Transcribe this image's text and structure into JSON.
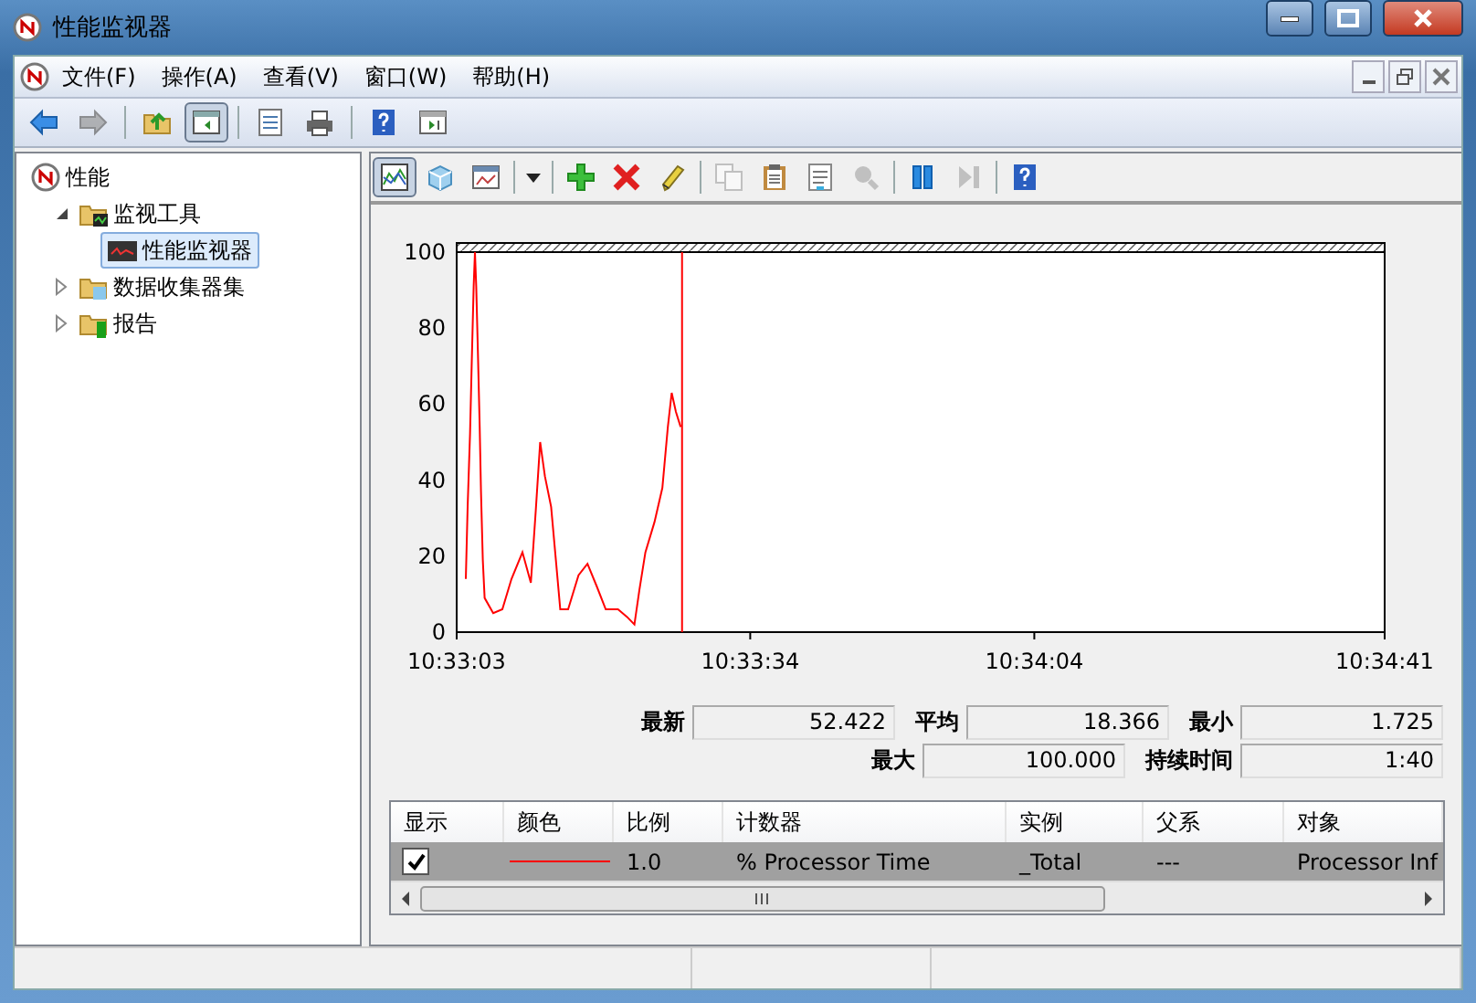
{
  "window": {
    "title": "性能监视器"
  },
  "menu": [
    "文件(F)",
    "操作(A)",
    "查看(V)",
    "窗口(W)",
    "帮助(H)"
  ],
  "toolbar": [
    {
      "pressed": false,
      "disabled": false
    },
    {
      "pressed": false,
      "disabled": true
    },
    {
      "pressed": false,
      "disabled": false
    },
    {
      "pressed": true,
      "disabled": false
    },
    {
      "pressed": false,
      "disabled": false
    },
    {
      "pressed": false,
      "disabled": false
    },
    {
      "pressed": false,
      "disabled": false
    },
    {
      "pressed": false,
      "disabled": false
    }
  ],
  "tree": [
    {
      "label": "性能",
      "selected": false,
      "children": [
        {
          "label": "监视工具",
          "expanded": true,
          "selected": false,
          "children": [
            {
              "label": "性能监视器",
              "selected": true
            }
          ]
        },
        {
          "label": "数据收集器集",
          "expanded": false,
          "selected": false
        },
        {
          "label": "报告",
          "expanded": false,
          "selected": false
        }
      ]
    }
  ],
  "graph_toolbar": [
    {
      "pressed": true,
      "disabled": false
    },
    {
      "pressed": false,
      "disabled": false
    },
    {
      "pressed": false,
      "disabled": false
    },
    {
      "pressed": false,
      "disabled": false
    },
    {
      "pressed": false,
      "disabled": false
    },
    {
      "pressed": false,
      "disabled": false
    },
    {
      "pressed": false,
      "disabled": false
    },
    {
      "pressed": false,
      "disabled": true
    },
    {
      "pressed": false,
      "disabled": false
    },
    {
      "pressed": false,
      "disabled": false
    },
    {
      "pressed": false,
      "disabled": true
    },
    {
      "pressed": false,
      "disabled": false
    },
    {
      "pressed": false,
      "disabled": true
    },
    {
      "pressed": false,
      "disabled": false
    }
  ],
  "graph": {
    "chart_data": {
      "type": "line",
      "xlim": [
        37983,
        38081
      ],
      "ylim": [
        0,
        100
      ],
      "yticks": [
        0,
        20,
        40,
        60,
        80,
        100
      ],
      "xticks": [
        {
          "value": 37983,
          "label": "10:33:03"
        },
        {
          "value": 38014,
          "label": "10:33:34"
        },
        {
          "value": 38044,
          "label": "10:34:04"
        },
        {
          "value": 38081,
          "label": "10:34:41"
        }
      ],
      "x": [
        37983.96,
        37984.16,
        37984.41,
        37984.61,
        37984.8,
        37984.93,
        37985.06,
        37985.25,
        37985.44,
        37985.57,
        37985.76,
        37985.96,
        37986.86,
        37987.82,
        37988.79,
        37989.94,
        37990.84,
        37991.36,
        37991.81,
        37992.32,
        37992.97,
        37993.48,
        37993.93,
        37994.77,
        37995.86,
        37996.82,
        37997.79,
        37998.75,
        38000.04,
        38001.0,
        38001.78,
        38002.29,
        38002.93,
        38003.9,
        38004.73,
        38005.31,
        38005.7,
        38006.15,
        38006.66
      ],
      "series": [
        {
          "color": "#ff0000",
          "values": [
            14,
            33,
            52,
            72,
            91,
            100,
            91,
            72,
            54,
            37,
            19,
            9,
            5,
            6,
            14,
            21,
            13,
            32,
            50,
            41,
            33,
            19,
            6,
            6,
            15,
            18,
            12,
            6,
            6,
            4,
            2,
            11,
            21,
            29,
            38,
            54,
            63,
            58,
            54
          ]
        }
      ],
      "ref_lines": [
        {
          "axis": "x",
          "value": 38006.8
        }
      ]
    }
  },
  "stats": [
    [
      {
        "label": "最新",
        "value": "52.422"
      },
      {
        "label": "平均",
        "value": "18.366"
      },
      {
        "label": "最小",
        "value": "1.725"
      }
    ],
    [
      {
        "label": "最大",
        "value": "100.000"
      },
      {
        "label": "持续时间",
        "value": "1:40"
      }
    ]
  ],
  "counters": {
    "columns": [
      "显示",
      "颜色",
      "比例",
      "计数器",
      "实例",
      "父系",
      "对象"
    ],
    "rows": [
      {
        "checked": true,
        "selected": true,
        "color": "#ff0000",
        "cells": [
          "",
          "",
          "1.0",
          "% Processor Time",
          "_Total",
          "---",
          "Processor Inf"
        ]
      }
    ]
  }
}
